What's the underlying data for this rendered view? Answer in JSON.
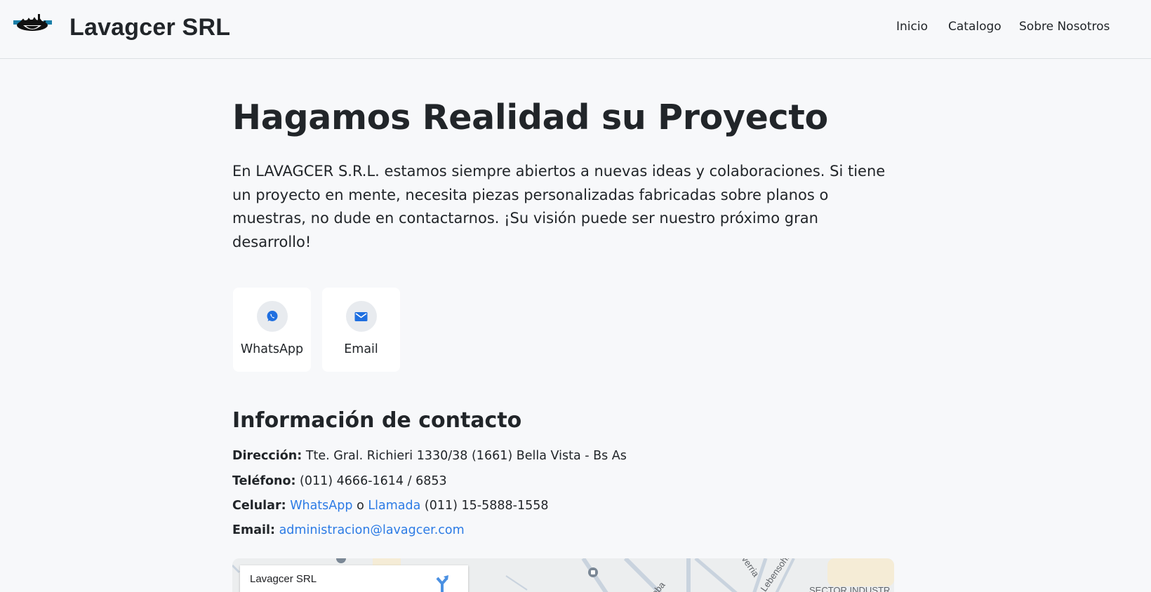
{
  "header": {
    "brand": "Lavagcer SRL",
    "nav": [
      {
        "label": "Inicio"
      },
      {
        "label": "Catalogo"
      },
      {
        "label": "Sobre Nosotros"
      }
    ]
  },
  "hero": {
    "title": "Hagamos Realidad su Proyecto",
    "text": "En LAVAGCER S.R.L. estamos siempre abiertos a nuevas ideas y colaboraciones. Si tiene un proyecto en mente, necesita piezas personalizadas fabricadas sobre planos o muestras, no dude en contactarnos. ¡Su visión puede ser nuestro próximo gran desarrollo!"
  },
  "contact_cards": [
    {
      "label": "WhatsApp",
      "icon": "whatsapp-icon"
    },
    {
      "label": "Email",
      "icon": "mail-icon"
    }
  ],
  "contact_info": {
    "title": "Información de contacto",
    "address_label": "Dirección:",
    "address_value": "Tte. Gral. Richieri 1330/38 (1661) Bella Vista - Bs As",
    "phone_label": "Teléfono:",
    "phone_value": "(011) 4666-1614 / 6853",
    "mobile_label": "Celular:",
    "mobile_whatsapp_link": "WhatsApp",
    "mobile_or": "o",
    "mobile_call_link": "Llamada",
    "mobile_value": "(011) 15-5888-1558",
    "email_label": "Email:",
    "email_value": "administracion@lavagcer.com"
  },
  "map": {
    "place_name": "Lavagcer SRL",
    "sector_label": "SECTOR INDUSTR",
    "street_1": "verria",
    "street_2": "Lebensohn",
    "street_3": "oba"
  },
  "colors": {
    "accent": "#2c7be5",
    "background": "#f7f8fa",
    "text": "#212529"
  }
}
